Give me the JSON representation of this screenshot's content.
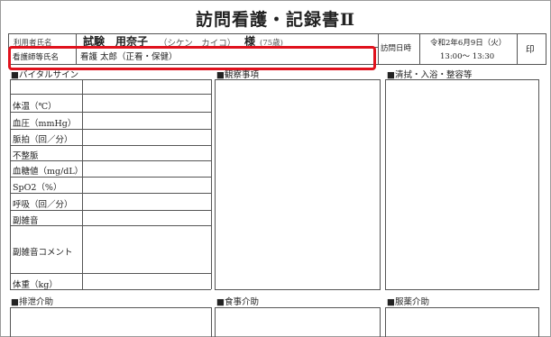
{
  "title": "訪問看護・記録書Ⅱ",
  "header": {
    "patient_label": "利用者氏名",
    "patient_name": "試験　用奈子",
    "patient_kana": "（シケン　カイコ）",
    "honorific": "様",
    "age": "(75歳)",
    "visit_label": "訪問日時",
    "visit_date": "令和2年6月9日（火）",
    "visit_time": "13:00～ 13:30",
    "seal": "印"
  },
  "nurse_row": {
    "label": "看護師等氏名",
    "value": "看護 太郎（正看・保健）"
  },
  "sections": {
    "vital": "■バイタルサイン",
    "observation": "■観察事項",
    "hygiene": "■清拭・入浴・整容等",
    "excretion": "■排泄介助",
    "meal": "■食事介助",
    "medication": "■服薬介助"
  },
  "vital_rows": [
    "体温（℃）",
    "血圧（mmHg）",
    "脈拍（回／分）",
    "不整脈",
    "血糖値（mg/dL）",
    "SpO2（%）",
    "呼吸（回／分）",
    "副雑音",
    "副雑音コメント",
    "体重（kg）"
  ],
  "highlight_color": "#e0121d"
}
